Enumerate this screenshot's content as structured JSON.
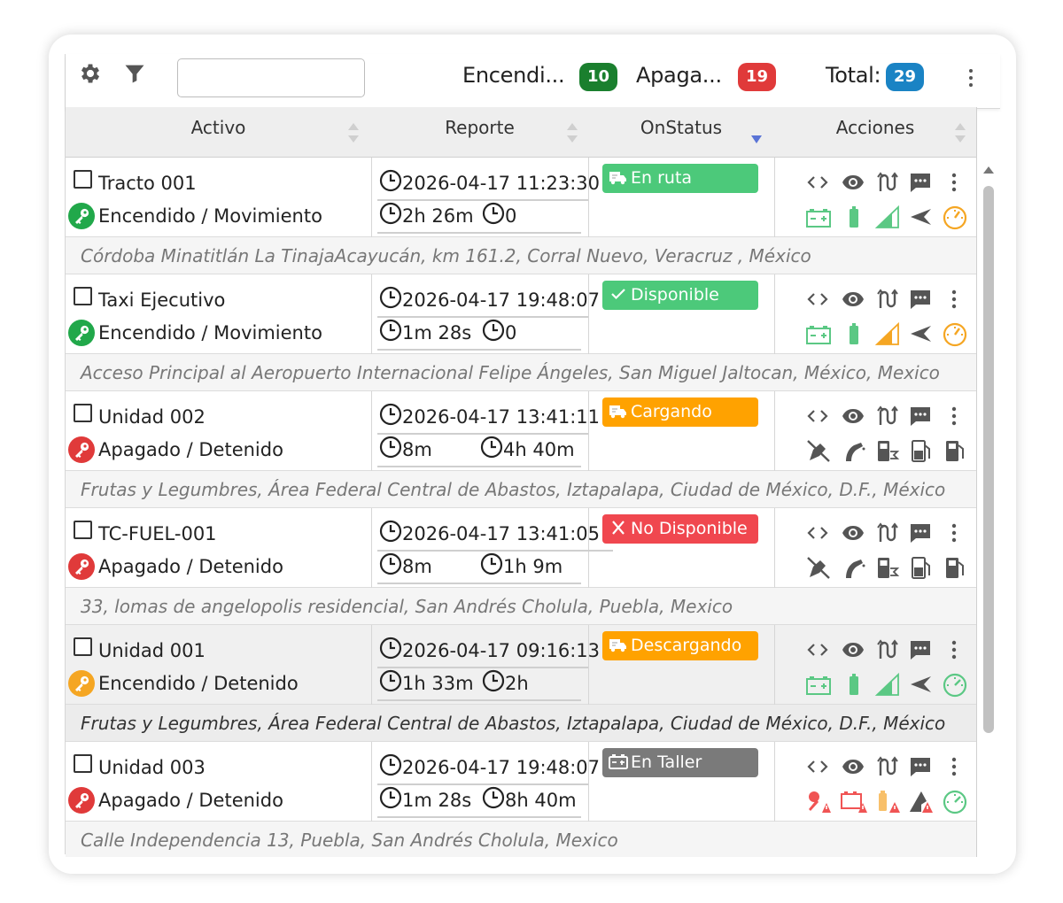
{
  "toolbar": {
    "search_value": "",
    "encendido_label": "Encendi...",
    "encendido_count": "10",
    "apagado_label": "Apaga...",
    "apagado_count": "19",
    "total_label": "Total:",
    "total_count": "29",
    "colors": {
      "encendido": "#1a7f2e",
      "apagado": "#e03a3a",
      "total": "#1a83c4"
    }
  },
  "columns": [
    {
      "label": "Activo"
    },
    {
      "label": "Reporte"
    },
    {
      "label": "OnStatus"
    },
    {
      "label": "Acciones"
    }
  ],
  "rows": [
    {
      "name": "Tracto 001",
      "state": "Encendido / Movimiento",
      "key_color": "#21a84a",
      "report_time": "2026-04-17 11:23:30",
      "duration_a": "2h 26m",
      "duration_b": "0",
      "status": "En ruta",
      "status_color": "#4cc97a",
      "status_icon": "truck-icon",
      "address": "Córdoba Minatitlán La TinajaAcayucán, km 161.2, Corral Nuevo, Veracruz , México",
      "sensors": [
        "battery-icon",
        "battery-level-icon",
        "signal-icon",
        "direction-icon",
        "speedometer-icon"
      ]
    },
    {
      "name": "Taxi Ejecutivo",
      "state": "Encendido / Movimiento",
      "key_color": "#21a84a",
      "report_time": "2026-04-17 19:48:07",
      "duration_a": "1m 28s",
      "duration_b": "0",
      "status": "Disponible",
      "status_color": "#4cc97a",
      "status_icon": "check-icon",
      "address": "Acceso Principal al Aeropuerto Internacional Felipe Ángeles, San Miguel Jaltocan, México, Mexico",
      "sensors": [
        "battery-icon",
        "battery-level-icon",
        "signal-icon",
        "direction-icon",
        "speedometer-icon"
      ]
    },
    {
      "name": "Unidad 002",
      "state": "Apagado / Detenido",
      "key_color": "#e03a3a",
      "report_time": "2026-04-17 13:41:11",
      "duration_a": "8m",
      "duration_b": "4h 40m",
      "status": "Cargando",
      "status_color": "#ffa200",
      "status_icon": "truck-icon",
      "address": "Frutas y Legumbres, Área Federal Central de Abastos, Iztapalapa, Ciudad de México, D.F., México",
      "sensors": [
        "fuel-off-icon",
        "fuel-nozzle-icon",
        "fuel-sum-icon",
        "fuel-level-icon",
        "fuel-tank-icon"
      ]
    },
    {
      "name": "TC-FUEL-001",
      "state": "Apagado / Detenido",
      "key_color": "#e03a3a",
      "report_time": "2026-04-17 13:41:05",
      "duration_a": "8m",
      "duration_b": "1h 9m",
      "status": "No Disponible",
      "status_color": "#f0474f",
      "status_icon": "x-icon",
      "address": "33, lomas de angelopolis residencial, San Andrés Cholula, Puebla, Mexico",
      "sensors": [
        "fuel-off-icon",
        "fuel-nozzle-icon",
        "fuel-sum-icon",
        "fuel-level-icon",
        "fuel-tank-icon"
      ]
    },
    {
      "name": "Unidad 001",
      "state": "Encendido / Detenido",
      "key_color": "#f5a623",
      "report_time": "2026-04-17 09:16:13",
      "duration_a": "1h 33m",
      "duration_b": "2h",
      "status": "Descargando",
      "status_color": "#ffa200",
      "status_icon": "truck-icon",
      "address": "Frutas y Legumbres, Área Federal Central de Abastos, Iztapalapa, Ciudad de México, D.F., México",
      "sensors": [
        "battery-icon",
        "battery-level-icon",
        "signal-icon",
        "direction-icon",
        "speedometer-icon"
      ]
    },
    {
      "name": "Unidad 003",
      "state": "Apagado / Detenido",
      "key_color": "#e03a3a",
      "report_time": "2026-04-17 19:48:07",
      "duration_a": "1m 28s",
      "duration_b": "8h 40m",
      "status": "En Taller",
      "status_color": "#7a7a7a",
      "status_icon": "battery-icon",
      "address": "Calle Independencia 13, Puebla, San Andrés Cholula, Mexico",
      "sensors": [
        "key-alert-icon",
        "battery-alert-icon",
        "fuel-alert-icon",
        "signal-alert-icon",
        "speedometer-icon"
      ]
    }
  ]
}
